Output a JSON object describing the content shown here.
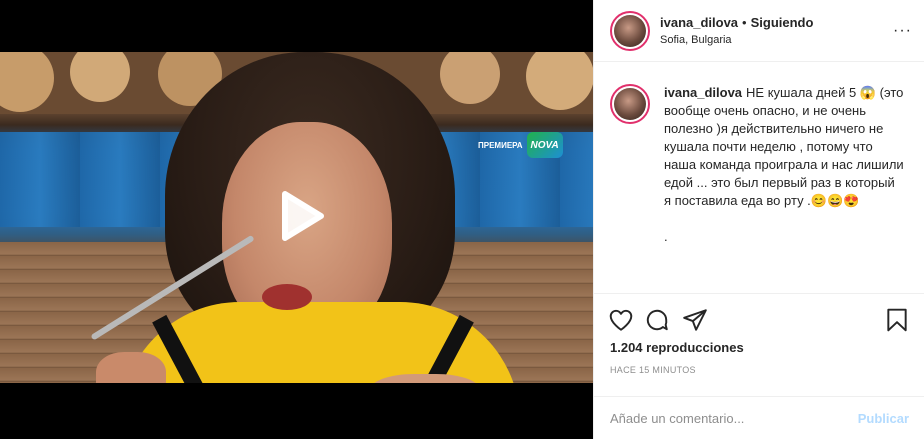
{
  "post": {
    "username": "ivana_dilova",
    "separator": "•",
    "follow_status": "Siguiendo",
    "location": "Sofia, Bulgaria",
    "more_menu": "···"
  },
  "video": {
    "channel_badge_text": "ПРЕМИЕРА",
    "channel_logo_text": "NOVA"
  },
  "caption": {
    "username": "ivana_dilova",
    "text": "НЕ кушала дней 5 😱 (это вообще очень опасно, и не очень полезно )я действительно ничего не кушала почти неделю , потому что наша команда проиграла и нас лишили едой ... это был первый раз в который я поставила еда во рту .😊😄😍",
    "trailing_dot": "."
  },
  "stats": {
    "views_label": "1.204 reproducciones",
    "timestamp": "HACE 15 MINUTOS"
  },
  "comment_bar": {
    "placeholder": "Añade un comentario...",
    "publish_label": "Publicar"
  },
  "icons": [
    "play-icon",
    "heart-icon",
    "comment-icon",
    "share-icon",
    "bookmark-icon",
    "more-icon"
  ],
  "colors": {
    "accent_ring": "#e1306c",
    "publish_disabled": "#b3dbff",
    "muted_text": "#8e8e8e"
  }
}
